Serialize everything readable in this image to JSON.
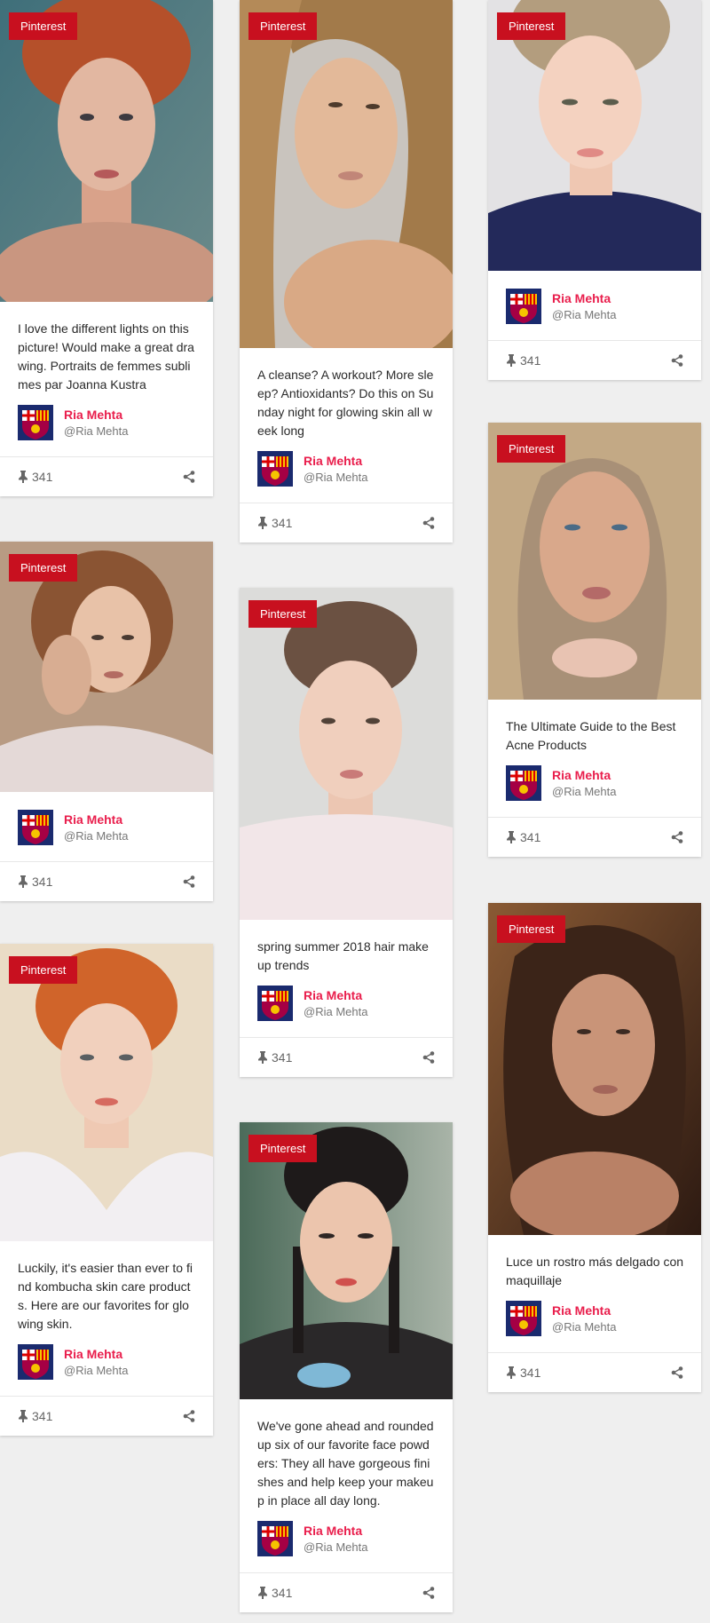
{
  "badge_label": "Pinterest",
  "accent_color": "#c8101f",
  "author_color": "#e91e4c",
  "cards": [
    {
      "desc": "I love the different lights on this picture! Would make a great drawing. Portraits de femmes sublimes par Joanna Kustra",
      "author": "Ria Mehta",
      "handle": "@Ria Mehta",
      "pins": "341"
    },
    {
      "desc": "",
      "author": "Ria Mehta",
      "handle": "@Ria Mehta",
      "pins": "341"
    },
    {
      "desc": "Luckily, it's easier than ever to find kombucha skin care products. Here are our favorites for glowing skin.",
      "author": "Ria Mehta",
      "handle": "@Ria Mehta",
      "pins": "341"
    },
    {
      "desc": "A cleanse? A workout? More sleep? Antioxidants? Do this on Sunday night for glowing skin all week long",
      "author": "Ria Mehta",
      "handle": "@Ria Mehta",
      "pins": "341"
    },
    {
      "desc": "spring summer 2018 hair makeup trends",
      "author": "Ria Mehta",
      "handle": "@Ria Mehta",
      "pins": "341"
    },
    {
      "desc": "We've gone ahead and rounded up six of our favorite face powders: They all have gorgeous finishes and help keep your makeup in place all day long.",
      "author": "Ria Mehta",
      "handle": "@Ria Mehta",
      "pins": "341"
    },
    {
      "desc": "",
      "author": "Ria Mehta",
      "handle": "@Ria Mehta",
      "pins": "341"
    },
    {
      "desc": "The Ultimate Guide to the Best Acne Products",
      "author": "Ria Mehta",
      "handle": "@Ria Mehta",
      "pins": "341"
    },
    {
      "desc": "Luce un rostro más delgado con maquillaje",
      "author": "Ria Mehta",
      "handle": "@Ria Mehta",
      "pins": "341"
    }
  ]
}
